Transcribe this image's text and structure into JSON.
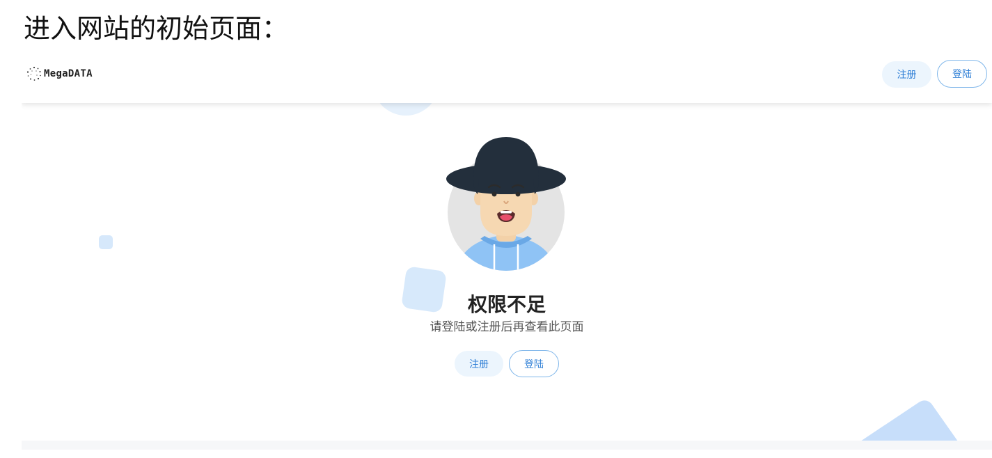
{
  "caption": "进入网站的初始页面：",
  "header": {
    "logo_text": "MegaDATA",
    "register_label": "注册",
    "login_label": "登陆"
  },
  "main": {
    "title": "权限不足",
    "subtitle": "请登陆或注册后再查看此页面",
    "register_label": "注册",
    "login_label": "登陆"
  },
  "colors": {
    "accent": "#2f7fd6",
    "button_fill": "#ecf5fd",
    "button_border": "#7fb6ea",
    "deco_blue": "#d7e9fb"
  },
  "icons": [
    "megadata-logo-icon",
    "confused-user-avatar-illustration"
  ]
}
